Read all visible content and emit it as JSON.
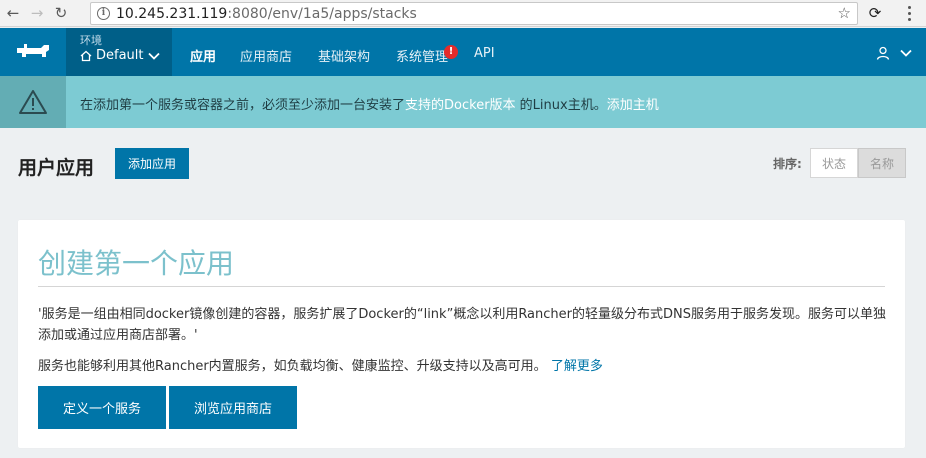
{
  "browser": {
    "url_host": "10.245.231.119",
    "url_rest": ":8080/env/1a5/apps/stacks"
  },
  "header": {
    "env_label": "环境",
    "env_value": "Default",
    "nav": [
      {
        "label": "应用"
      },
      {
        "label": "应用商店"
      },
      {
        "label": "基础架构"
      },
      {
        "label": "系统管理"
      },
      {
        "label": "API"
      }
    ],
    "badge": "!"
  },
  "alert": {
    "text_before": "在添加第一个服务或容器之前，必须至少添加一台安装了",
    "link_docker": "支持的Docker版本",
    "text_middle": " 的Linux主机。",
    "link_add_host": "添加主机"
  },
  "page": {
    "title": "用户应用",
    "add_button": "添加应用",
    "sort_label": "排序:",
    "sort_options": [
      "状态",
      "名称"
    ],
    "sort_selected": "名称"
  },
  "card": {
    "title": "创建第一个应用",
    "paragraph1": "'服务是一组由相同docker镜像创建的容器，服务扩展了Docker的“link”概念以利用Rancher的轻量级分布式DNS服务用于服务发现。服务可以单独添加或通过应用商店部署。'",
    "paragraph2": "服务也能够利用其他Rancher内置服务，如负载均衡、健康监控、升级支持以及高可用。",
    "learn_more": "了解更多",
    "button_define": "定义一个服务",
    "button_browse": "浏览应用商店"
  },
  "colors": {
    "brand": "#0075a8",
    "header_dark": "#005f88",
    "alert_bg": "#7dcbd3",
    "card_title": "#7cc1cc"
  }
}
